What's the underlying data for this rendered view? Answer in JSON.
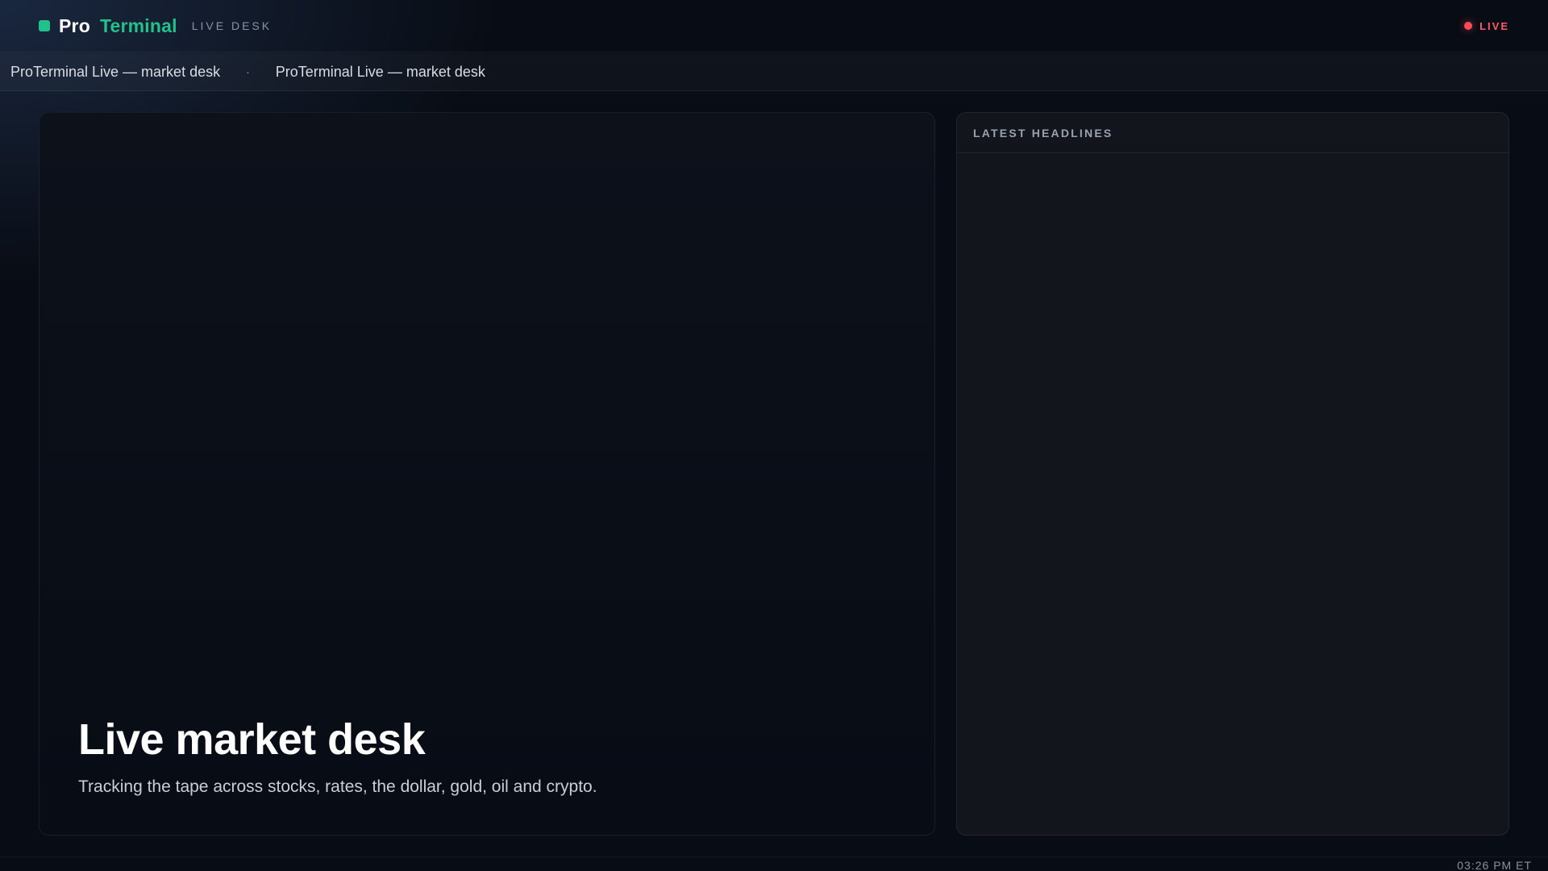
{
  "header": {
    "brand_pro": "Pro",
    "brand_terminal": "Terminal",
    "brand_sub": "LIVE DESK",
    "live_label": "LIVE"
  },
  "ticker": {
    "items": [
      "ProTerminal Live — market desk",
      "ProTerminal Live — market desk"
    ],
    "separator": "·"
  },
  "hero": {
    "title": "Live market desk",
    "subtitle": "Tracking the tape across stocks, rates, the dollar, gold, oil and crypto."
  },
  "headlines": {
    "title": "LATEST HEADLINES",
    "items": []
  },
  "footer": {
    "time": "03:26 PM ET"
  },
  "colors": {
    "accent": "#22c08b",
    "live": "#ff4a5c",
    "background": "#080c14"
  }
}
